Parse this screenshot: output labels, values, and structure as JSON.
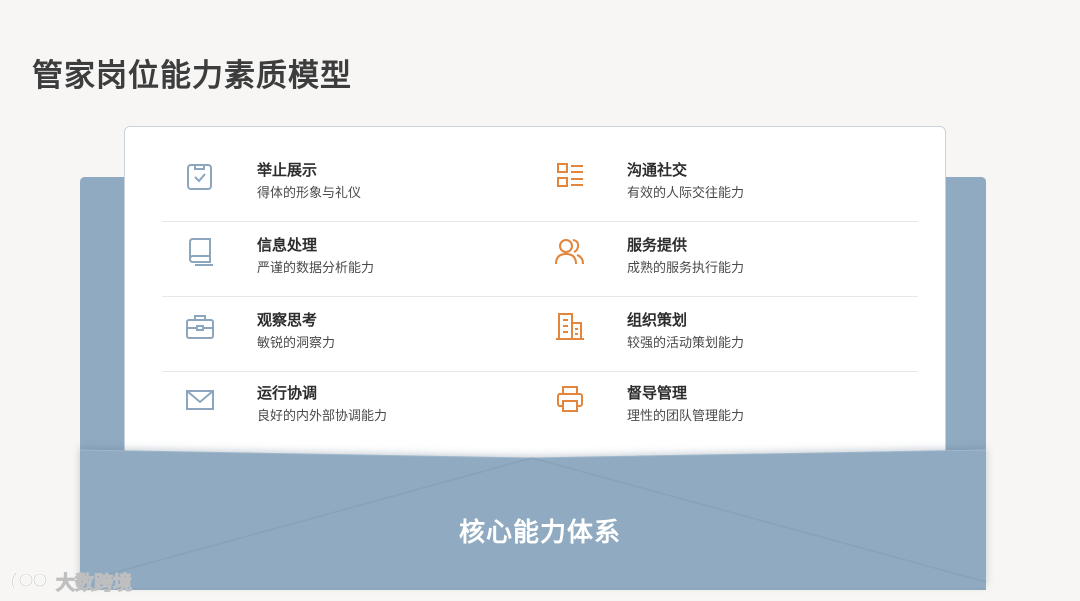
{
  "page": {
    "title": "管家岗位能力素质模型"
  },
  "envelope": {
    "label": "核心能力体系"
  },
  "colors": {
    "envelope": "#8faac1",
    "icon_blue": "#8ca6bd",
    "icon_orange": "#e3853a"
  },
  "items": [
    {
      "title": "举止展示",
      "desc": "得体的形象与礼仪",
      "icon": "clipboard-check-icon"
    },
    {
      "title": "沟通社交",
      "desc": "有效的人际交往能力",
      "icon": "list-icon"
    },
    {
      "title": "信息处理",
      "desc": "严谨的数据分析能力",
      "icon": "book-icon"
    },
    {
      "title": "服务提供",
      "desc": "成熟的服务执行能力",
      "icon": "users-icon"
    },
    {
      "title": "观察思考",
      "desc": "敏锐的洞察力",
      "icon": "briefcase-icon"
    },
    {
      "title": "组织策划",
      "desc": "较强的活动策划能力",
      "icon": "building-icon"
    },
    {
      "title": "运行协调",
      "desc": "良好的内外部协调能力",
      "icon": "mail-icon"
    },
    {
      "title": "督导管理",
      "desc": "理性的团队管理能力",
      "icon": "printer-icon"
    }
  ],
  "watermark": {
    "text": "大数跨境"
  }
}
